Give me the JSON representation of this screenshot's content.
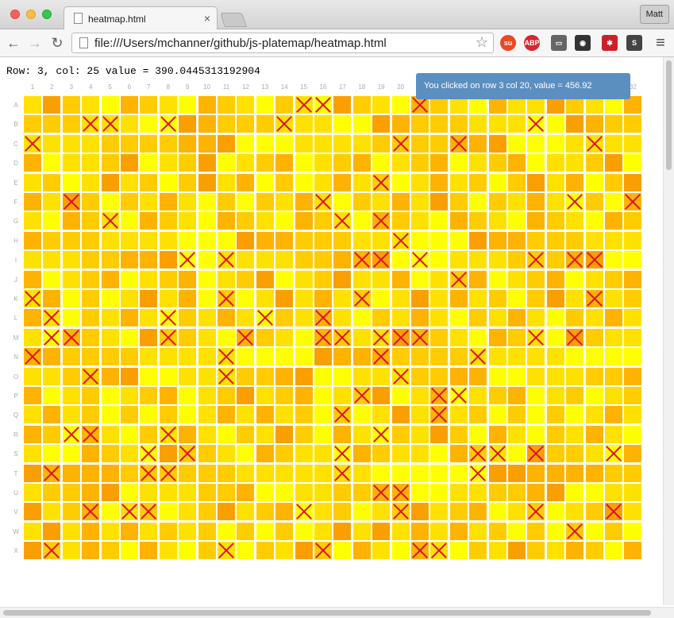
{
  "browser": {
    "tab_title": "heatmap.html",
    "tab_close": "×",
    "profile_name": "Matt",
    "url": "file:///Users/mchanner/github/js-platemap/heatmap.html",
    "back": "←",
    "forward": "→",
    "reload": "↻",
    "star": "☆",
    "menu": "≡",
    "extensions": [
      {
        "name": "stumbleupon-icon",
        "label": "su",
        "color": "#eb4924"
      },
      {
        "name": "adblock-plus-icon",
        "label": "ABP",
        "color": "#d7262d"
      },
      {
        "name": "cast-icon",
        "label": "▭",
        "color": "#666666"
      },
      {
        "name": "incognito-icon",
        "label": "◉",
        "color": "#333333"
      },
      {
        "name": "lastpass-icon",
        "label": "✱",
        "color": "#cc2127"
      },
      {
        "name": "s-extension-icon",
        "label": "S",
        "color": "#444444"
      }
    ]
  },
  "page": {
    "status_text": "Row: 3, col: 25 value = 390.0445313192904",
    "tooltip_text": "You clicked on row 3 col 20, value = 456.92"
  },
  "plate": {
    "columns": [
      "1",
      "2",
      "3",
      "4",
      "5",
      "6",
      "7",
      "8",
      "9",
      "10",
      "11",
      "12",
      "13",
      "14",
      "15",
      "16",
      "17",
      "18",
      "19",
      "20",
      "21",
      "22",
      "23",
      "24",
      "25",
      "26",
      "27",
      "28",
      "29",
      "30",
      "31",
      "32"
    ],
    "rows": [
      "A",
      "B",
      "C",
      "D",
      "E",
      "F",
      "G",
      "H",
      "I",
      "J",
      "K",
      "L",
      "M",
      "N",
      "O",
      "P",
      "Q",
      "R",
      "S",
      "T",
      "U",
      "V",
      "W",
      "X"
    ],
    "colors": [
      "#ffff00",
      "#ffe100",
      "#ffcc00",
      "#fdb300",
      "#f9a000"
    ],
    "marked": {
      "A": [
        15,
        16,
        21
      ],
      "B": [
        4,
        5,
        8,
        14,
        27
      ],
      "C": [
        1,
        20,
        23,
        30
      ],
      "E": [
        19
      ],
      "F": [
        3,
        16,
        29,
        32
      ],
      "G": [
        5,
        17,
        19
      ],
      "H": [
        20
      ],
      "I": [
        9,
        11,
        18,
        19,
        21,
        27,
        29,
        30
      ],
      "J": [
        23
      ],
      "K": [
        1,
        11,
        18,
        30
      ],
      "L": [
        2,
        8,
        13,
        16
      ],
      "M": [
        2,
        3,
        8,
        12,
        16,
        17,
        19,
        20,
        21,
        27,
        29
      ],
      "N": [
        1,
        11,
        19,
        24
      ],
      "O": [
        4,
        11,
        20
      ],
      "P": [
        18,
        22,
        23
      ],
      "Q": [
        17,
        22
      ],
      "R": [
        3,
        4,
        8,
        19
      ],
      "S": [
        7,
        9,
        17,
        24,
        25,
        27,
        31
      ],
      "T": [
        2,
        7,
        8,
        17,
        24
      ],
      "U": [
        19,
        20
      ],
      "V": [
        4,
        6,
        7,
        15,
        20,
        27,
        31
      ],
      "W": [
        29
      ],
      "X": [
        2,
        11,
        16,
        21,
        22
      ]
    }
  }
}
